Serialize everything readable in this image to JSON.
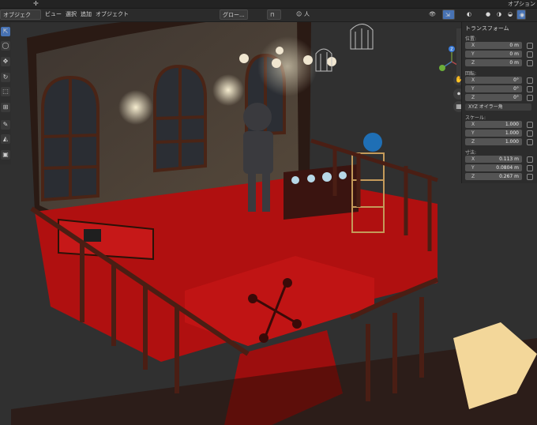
{
  "topbar": {
    "right_label": "オプション"
  },
  "header": {
    "mode": "オブジェクト...",
    "menus": [
      "ビュー",
      "選択",
      "追加",
      "オブジェクト"
    ],
    "orientation": "グロー...",
    "snap_icon": "magnet-icon",
    "proportional_icon": "person-icon",
    "person_label": "人"
  },
  "tools": [
    "cursor-icon",
    "circle-icon",
    "move-icon",
    "rotate-icon",
    "scale-icon",
    "transform-icon",
    "annotate-icon",
    "measure-icon",
    "cube-add-icon"
  ],
  "gizmo": {
    "x": "X",
    "y": "Y",
    "z": "Z"
  },
  "npanel": {
    "title": "トランスフォーム",
    "location_label": "位置:",
    "location": [
      {
        "axis": "X",
        "value": "0 m"
      },
      {
        "axis": "Y",
        "value": "0 m"
      },
      {
        "axis": "Z",
        "value": "0 m"
      }
    ],
    "rotation_label": "回転:",
    "rotation": [
      {
        "axis": "X",
        "value": "0°"
      },
      {
        "axis": "Y",
        "value": "0°"
      },
      {
        "axis": "Z",
        "value": "0°"
      }
    ],
    "rotation_mode": "XYZ オイラー角",
    "scale_label": "スケール:",
    "scale": [
      {
        "axis": "X",
        "value": "1.000"
      },
      {
        "axis": "Y",
        "value": "1.000"
      },
      {
        "axis": "Z",
        "value": "1.000"
      }
    ],
    "dimensions_label": "寸法:",
    "dimensions": [
      {
        "axis": "X",
        "value": "0.113 m"
      },
      {
        "axis": "Y",
        "value": "0.0804 m"
      },
      {
        "axis": "Z",
        "value": "0.267 m"
      }
    ]
  },
  "colors": {
    "carpet": "#b01010",
    "wall": "#4a4036",
    "wood": "#3a1c14",
    "bg": "#303030",
    "accent": "#4772b3"
  }
}
